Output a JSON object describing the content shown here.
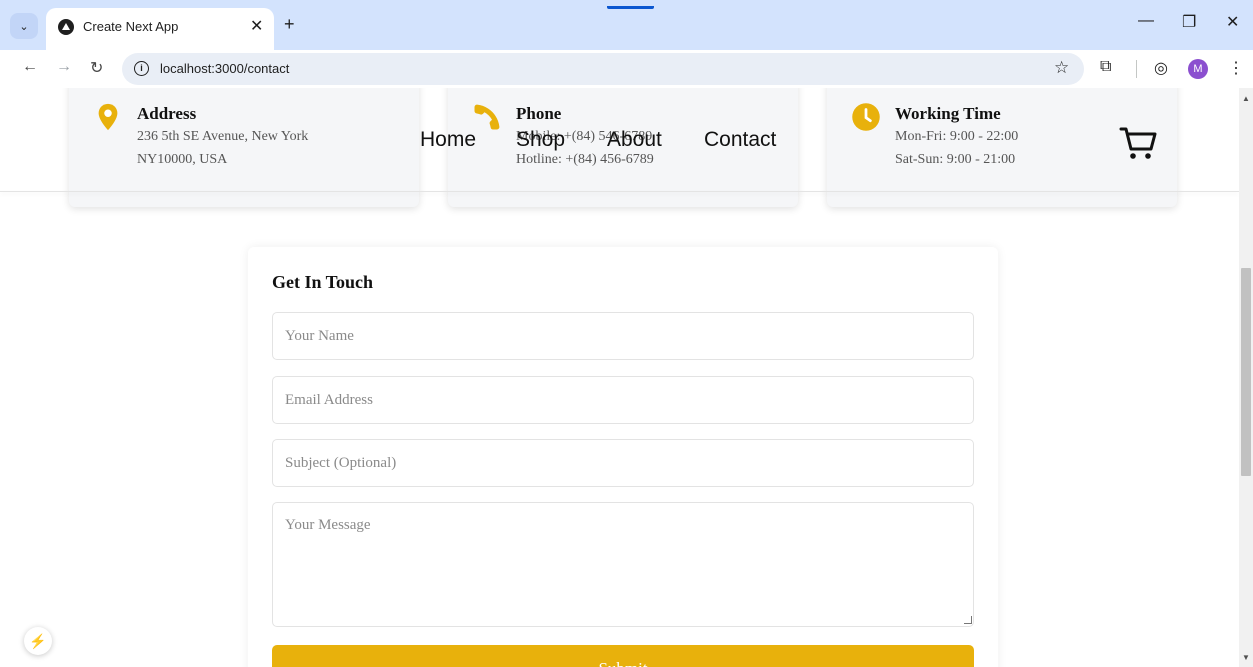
{
  "browser": {
    "tab_title": "Create Next App",
    "tab_close": "✕",
    "new_tab": "+",
    "tab_search": "⌄",
    "url": "localhost:3000/contact",
    "nav": {
      "back": "←",
      "forward": "→",
      "reload": "↻"
    },
    "window": {
      "minimize": "—",
      "restore": "❐",
      "close": "✕"
    },
    "profile_initial": "M",
    "star": "☆",
    "menu": "⋮",
    "extensions": "⧉",
    "assistant": "◎"
  },
  "info_cards": [
    {
      "icon": "location-pin-icon",
      "title": "Address",
      "lines": [
        "236 5th SE Avenue, New York",
        "NY10000, USA"
      ]
    },
    {
      "icon": "phone-icon",
      "title": "Phone",
      "lines": [
        "Mobile: +(84) 546-6789",
        "Hotline: +(84) 456-6789"
      ]
    },
    {
      "icon": "clock-icon",
      "title": "Working Time",
      "lines": [
        "Mon-Fri: 9:00 - 22:00",
        "Sat-Sun: 9:00 - 21:00"
      ]
    }
  ],
  "nav_links": [
    "Home",
    "Shop",
    "About",
    "Contact"
  ],
  "contact_form": {
    "title": "Get In Touch",
    "name_placeholder": "Your Name",
    "email_placeholder": "Email Address",
    "subject_placeholder": "Subject (Optional)",
    "message_placeholder": "Your Message",
    "submit_label": "Submit"
  },
  "colors": {
    "accent": "#e8b10c",
    "chrome": "#d3e3fd"
  },
  "dev_tools_icon": "⚡"
}
